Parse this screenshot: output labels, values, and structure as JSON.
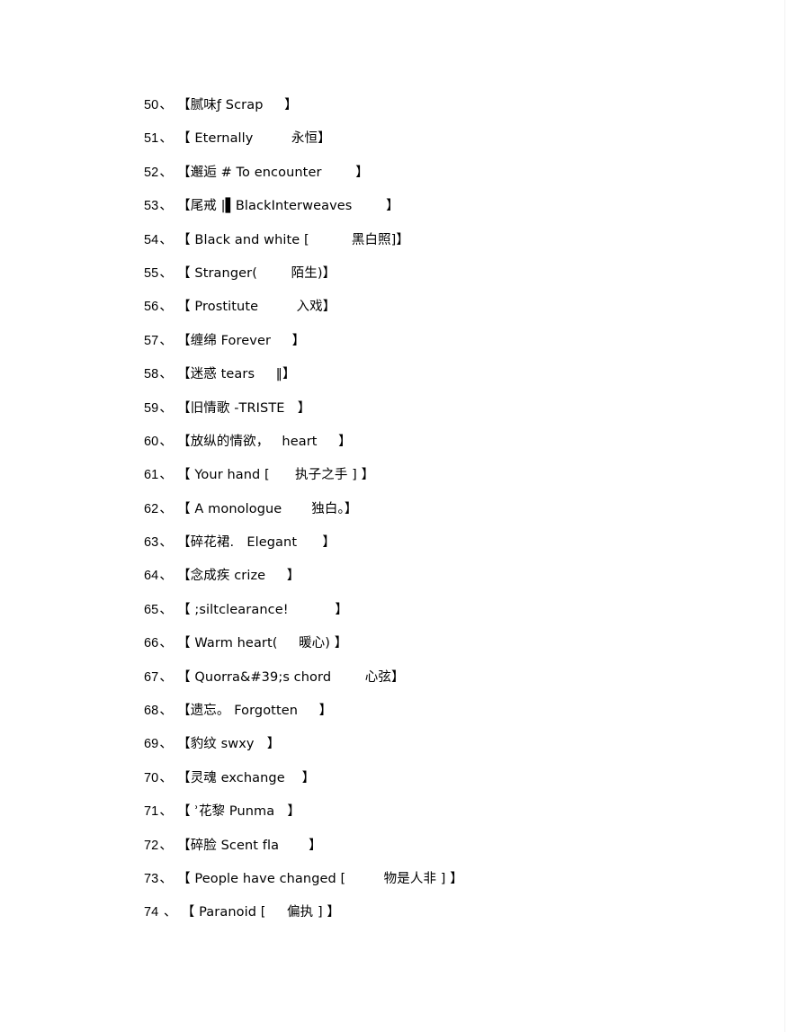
{
  "document": {
    "page_background": "#ffffff",
    "text_color": "#000000",
    "frame_rule_color": "#f2f2f2",
    "list_separator": "、",
    "bracket_open": "【",
    "bracket_close": "】",
    "entries": [
      {
        "number": "50",
        "separator": "、",
        "text": "【腻味ƒ Scrap     】"
      },
      {
        "number": "51",
        "separator": "、",
        "text": "【 Eternally         永恒】"
      },
      {
        "number": "52",
        "separator": "、",
        "text": "【邂逅 # To encounter        】"
      },
      {
        "number": "53",
        "separator": "、",
        "text": "【尾戒 |▌BlackInterweaves        】"
      },
      {
        "number": "54",
        "separator": "、",
        "text": "【 Black and white [          黑白照]】"
      },
      {
        "number": "55",
        "separator": "、",
        "text": "【 Stranger(        陌生)】"
      },
      {
        "number": "56",
        "separator": "、",
        "text": "【 Prostitute         入戏】"
      },
      {
        "number": "57",
        "separator": "、",
        "text": "【缠绵 Forever     】"
      },
      {
        "number": "58",
        "separator": "、",
        "text": "【迷惑 tears     ‖】"
      },
      {
        "number": "59",
        "separator": "、",
        "text": "【旧情歌 -TRISTE   】"
      },
      {
        "number": "60",
        "separator": "、",
        "text": "【放纵的情欲，   heart     】"
      },
      {
        "number": "61",
        "separator": "、",
        "text": "【 Your hand [      执子之手 ] 】"
      },
      {
        "number": "62",
        "separator": "、",
        "text": "【 A monologue       独白。】"
      },
      {
        "number": "63",
        "separator": "、",
        "text": "【碎花裙.   Elegant      】"
      },
      {
        "number": "64",
        "separator": "、",
        "text": "【念成疾 crize     】"
      },
      {
        "number": "65",
        "separator": "、",
        "text": "【 ;siltclearance!           】"
      },
      {
        "number": "66",
        "separator": "、",
        "text": "【 Warm heart(     暖心) 】"
      },
      {
        "number": "67",
        "separator": "、",
        "text": "【 Quorra&#39;s chord        心弦】"
      },
      {
        "number": "68",
        "separator": "、",
        "text": "【遗忘。 Forgotten     】"
      },
      {
        "number": "69",
        "separator": "、",
        "text": "【豹纹 swxy   】"
      },
      {
        "number": "70",
        "separator": "、",
        "text": "【灵魂 exchange    】"
      },
      {
        "number": "71",
        "separator": "、",
        "text": "【 ʾ花黎 Punma   】"
      },
      {
        "number": "72",
        "separator": "、",
        "text": "【碎脸 Scent fla       】"
      },
      {
        "number": "73",
        "separator": "、",
        "text": "【 People have changed [         物是人非 ] 】"
      },
      {
        "number": "74",
        "separator": " 、",
        "text": "【 Paranoid [     偏执 ] 】"
      }
    ]
  }
}
